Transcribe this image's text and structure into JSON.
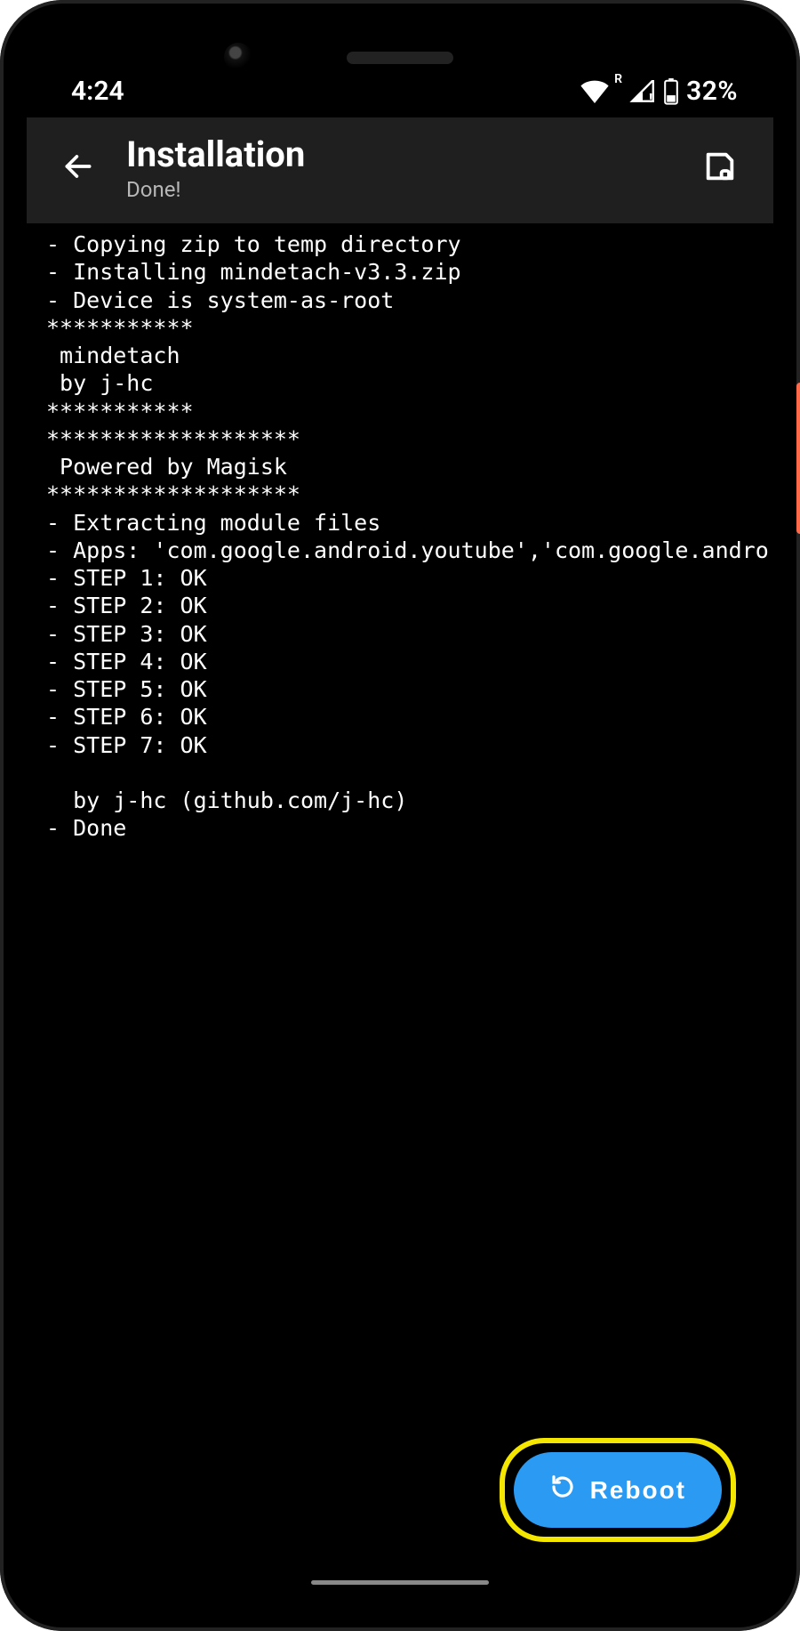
{
  "status_bar": {
    "time": "4:24",
    "battery_text": "32%",
    "roaming_badge": "R"
  },
  "header": {
    "title": "Installation",
    "subtitle": "Done!"
  },
  "log_text": "- Copying zip to temp directory\n- Installing mindetach-v3.3.zip\n- Device is system-as-root\n***********\n mindetach\n by j-hc\n***********\n*******************\n Powered by Magisk\n*******************\n- Extracting module files\n- Apps: 'com.google.android.youtube','com.google.andro\n- STEP 1: OK\n- STEP 2: OK\n- STEP 3: OK\n- STEP 4: OK\n- STEP 5: OK\n- STEP 6: OK\n- STEP 7: OK\n\n  by j-hc (github.com/j-hc)\n- Done",
  "fab": {
    "label": "Reboot"
  },
  "colors": {
    "accent": "#2b9af3",
    "highlight_border": "#f5e600",
    "appbar_bg": "#1f1f1f",
    "side_button": "#ff6b4a"
  }
}
